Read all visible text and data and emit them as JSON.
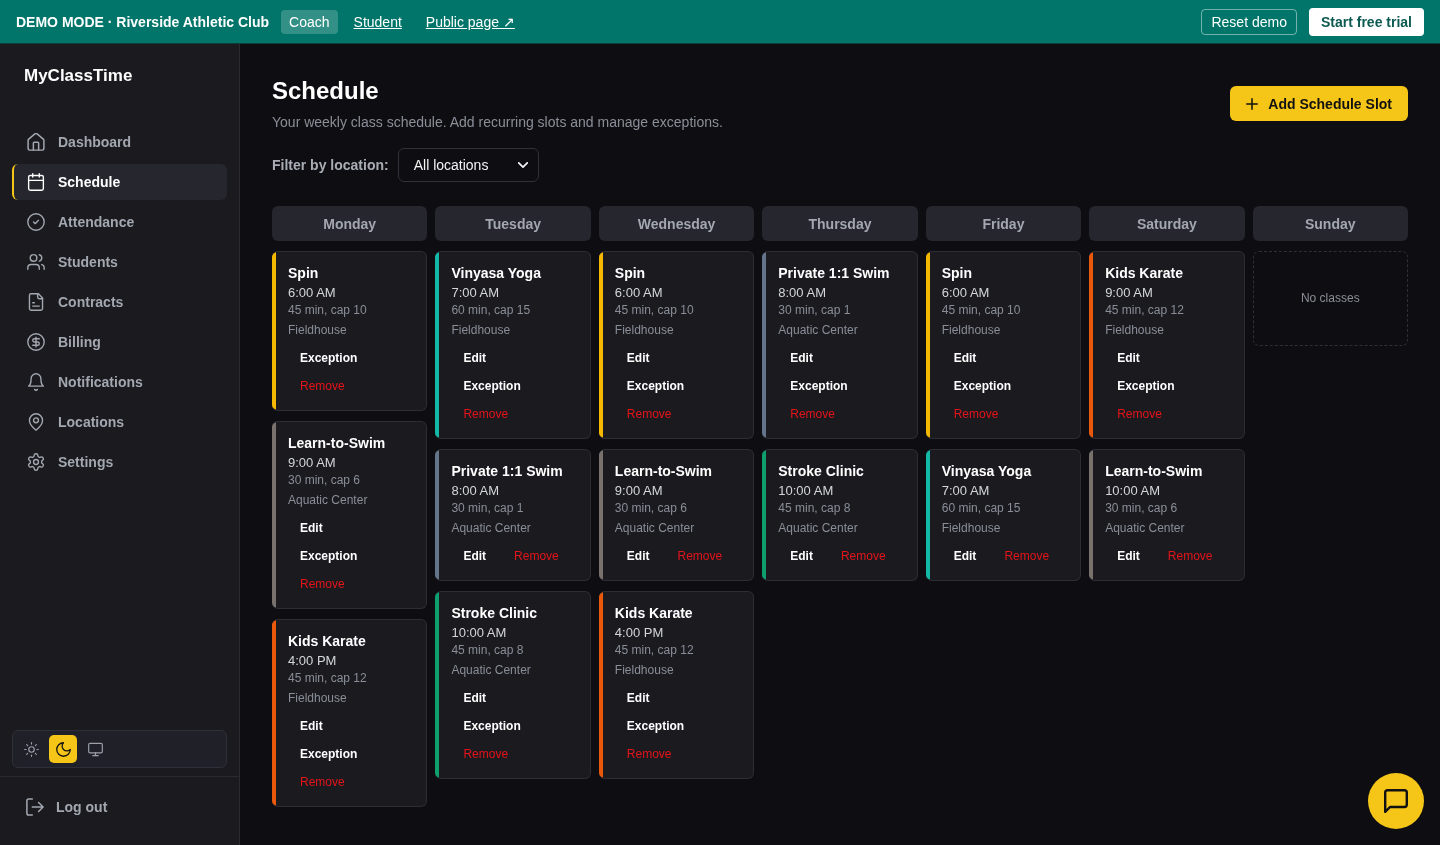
{
  "top_bar": {
    "mode_label": "DEMO MODE · Riverside Athletic Club",
    "views": [
      {
        "label": "Coach",
        "selected": true
      },
      {
        "label": "Student",
        "selected": false
      },
      {
        "label": "Public page ↗",
        "selected": false
      }
    ],
    "reset_button": "Reset demo",
    "trial_button": "Start free trial"
  },
  "sidebar": {
    "brand": "MyClassTime",
    "items": [
      {
        "label": "Dashboard",
        "selected": false
      },
      {
        "label": "Schedule",
        "selected": true
      },
      {
        "label": "Attendance",
        "selected": false
      },
      {
        "label": "Students",
        "selected": false
      },
      {
        "label": "Contracts",
        "selected": false
      },
      {
        "label": "Billing",
        "selected": false
      },
      {
        "label": "Notifications",
        "selected": false
      },
      {
        "label": "Locations",
        "selected": false
      },
      {
        "label": "Settings",
        "selected": false
      }
    ],
    "theme_options": [
      {
        "selected": false
      },
      {
        "selected": true
      },
      {
        "selected": false
      }
    ],
    "logout": "Log out"
  },
  "page": {
    "title": "Schedule",
    "subtitle": "Your weekly class schedule. Add recurring slots and manage exceptions.",
    "add_button": "Add Schedule Slot",
    "filter": {
      "label": "Filter by location:",
      "value": "All locations"
    }
  },
  "week": [
    {
      "name": "Monday",
      "slots": [
        {
          "class": "Spin",
          "time": "6:00 AM",
          "details": "45 min, cap 10",
          "location": "Fieldhouse",
          "color": "#f5b800",
          "actions": [
            {
              "label": "Exception",
              "kind": "plain"
            },
            {
              "label": "Remove",
              "kind": "danger"
            }
          ]
        },
        {
          "class": "Learn-to-Swim",
          "time": "9:00 AM",
          "details": "30 min, cap 6",
          "location": "Aquatic Center",
          "color": "#78716c",
          "actions": [
            {
              "label": "Edit",
              "kind": "plain"
            },
            {
              "label": "Exception",
              "kind": "plain"
            },
            {
              "label": "Remove",
              "kind": "danger"
            }
          ]
        },
        {
          "class": "Kids Karate",
          "time": "4:00 PM",
          "details": "45 min, cap 12",
          "location": "Fieldhouse",
          "color": "#ea580c",
          "actions": [
            {
              "label": "Edit",
              "kind": "plain"
            },
            {
              "label": "Exception",
              "kind": "plain"
            },
            {
              "label": "Remove",
              "kind": "danger"
            }
          ]
        }
      ]
    },
    {
      "name": "Tuesday",
      "slots": [
        {
          "class": "Vinyasa Yoga",
          "time": "7:00 AM",
          "details": "60 min, cap 15",
          "location": "Fieldhouse",
          "color": "#14b8a6",
          "actions": [
            {
              "label": "Edit",
              "kind": "plain"
            },
            {
              "label": "Exception",
              "kind": "plain"
            },
            {
              "label": "Remove",
              "kind": "danger"
            }
          ]
        },
        {
          "class": "Private 1:1 Swim",
          "time": "8:00 AM",
          "details": "30 min, cap 1",
          "location": "Aquatic Center",
          "color": "#64748b",
          "actions": [
            {
              "label": "Edit",
              "kind": "plain"
            },
            {
              "label": "Remove",
              "kind": "danger"
            }
          ]
        },
        {
          "class": "Stroke Clinic",
          "time": "10:00 AM",
          "details": "45 min, cap 8",
          "location": "Aquatic Center",
          "color": "#0d9f6e",
          "actions": [
            {
              "label": "Edit",
              "kind": "plain"
            },
            {
              "label": "Exception",
              "kind": "plain"
            },
            {
              "label": "Remove",
              "kind": "danger"
            }
          ]
        }
      ]
    },
    {
      "name": "Wednesday",
      "slots": [
        {
          "class": "Spin",
          "time": "6:00 AM",
          "details": "45 min, cap 10",
          "location": "Fieldhouse",
          "color": "#f5b800",
          "actions": [
            {
              "label": "Edit",
              "kind": "plain"
            },
            {
              "label": "Exception",
              "kind": "plain"
            },
            {
              "label": "Remove",
              "kind": "danger"
            }
          ]
        },
        {
          "class": "Learn-to-Swim",
          "time": "9:00 AM",
          "details": "30 min, cap 6",
          "location": "Aquatic Center",
          "color": "#78716c",
          "actions": [
            {
              "label": "Edit",
              "kind": "plain"
            },
            {
              "label": "Remove",
              "kind": "danger"
            }
          ]
        },
        {
          "class": "Kids Karate",
          "time": "4:00 PM",
          "details": "45 min, cap 12",
          "location": "Fieldhouse",
          "color": "#ea580c",
          "actions": [
            {
              "label": "Edit",
              "kind": "plain"
            },
            {
              "label": "Exception",
              "kind": "plain"
            },
            {
              "label": "Remove",
              "kind": "danger"
            }
          ]
        }
      ]
    },
    {
      "name": "Thursday",
      "slots": [
        {
          "class": "Private 1:1 Swim",
          "time": "8:00 AM",
          "details": "30 min, cap 1",
          "location": "Aquatic Center",
          "color": "#64748b",
          "actions": [
            {
              "label": "Edit",
              "kind": "plain"
            },
            {
              "label": "Exception",
              "kind": "plain"
            },
            {
              "label": "Remove",
              "kind": "danger"
            }
          ]
        },
        {
          "class": "Stroke Clinic",
          "time": "10:00 AM",
          "details": "45 min, cap 8",
          "location": "Aquatic Center",
          "color": "#0d9f6e",
          "actions": [
            {
              "label": "Edit",
              "kind": "plain"
            },
            {
              "label": "Remove",
              "kind": "danger"
            }
          ]
        }
      ]
    },
    {
      "name": "Friday",
      "slots": [
        {
          "class": "Spin",
          "time": "6:00 AM",
          "details": "45 min, cap 10",
          "location": "Fieldhouse",
          "color": "#f5b800",
          "actions": [
            {
              "label": "Edit",
              "kind": "plain"
            },
            {
              "label": "Exception",
              "kind": "plain"
            },
            {
              "label": "Remove",
              "kind": "danger"
            }
          ]
        },
        {
          "class": "Vinyasa Yoga",
          "time": "7:00 AM",
          "details": "60 min, cap 15",
          "location": "Fieldhouse",
          "color": "#14b8a6",
          "actions": [
            {
              "label": "Edit",
              "kind": "plain"
            },
            {
              "label": "Remove",
              "kind": "danger"
            }
          ]
        }
      ]
    },
    {
      "name": "Saturday",
      "slots": [
        {
          "class": "Kids Karate",
          "time": "9:00 AM",
          "details": "45 min, cap 12",
          "location": "Fieldhouse",
          "color": "#ea580c",
          "actions": [
            {
              "label": "Edit",
              "kind": "plain"
            },
            {
              "label": "Exception",
              "kind": "plain"
            },
            {
              "label": "Remove",
              "kind": "danger"
            }
          ]
        },
        {
          "class": "Learn-to-Swim",
          "time": "10:00 AM",
          "details": "30 min, cap 6",
          "location": "Aquatic Center",
          "color": "#78716c",
          "actions": [
            {
              "label": "Edit",
              "kind": "plain"
            },
            {
              "label": "Remove",
              "kind": "danger"
            }
          ]
        }
      ]
    },
    {
      "name": "Sunday",
      "empty_text": "No classes"
    }
  ]
}
